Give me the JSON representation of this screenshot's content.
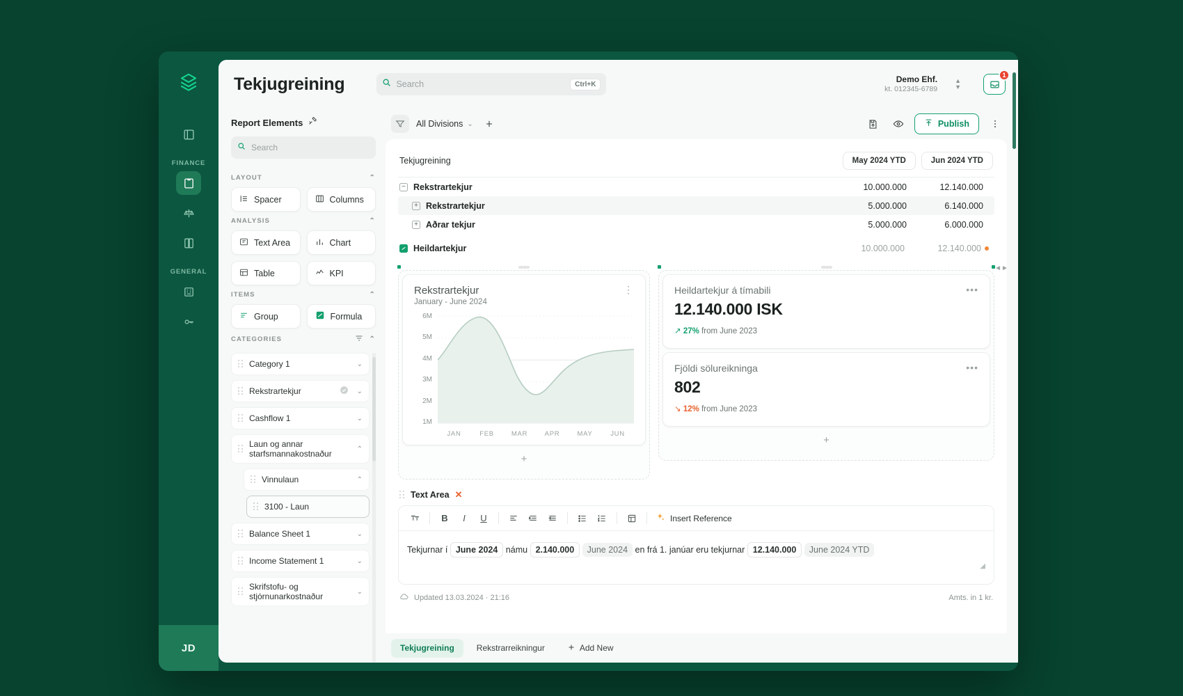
{
  "brand": {
    "accent": "#14a06e",
    "bg": "#07432f",
    "panel": "#0c5740"
  },
  "rail": {
    "logo_icon": "layers-logo-icon",
    "groups": [
      {
        "label": "FINANCE",
        "items": [
          {
            "icon": "dashboard-icon",
            "name": "dashboard",
            "active": false
          },
          {
            "icon": "clipboard-icon",
            "name": "reports",
            "active": true
          },
          {
            "icon": "scales-icon",
            "name": "balance",
            "active": false
          },
          {
            "icon": "book-icon",
            "name": "ledger",
            "active": false
          }
        ]
      },
      {
        "label": "GENERAL",
        "items": [
          {
            "icon": "building-icon",
            "name": "company",
            "active": false
          },
          {
            "icon": "key-icon",
            "name": "access",
            "active": false
          }
        ]
      }
    ],
    "avatar_initials": "JD"
  },
  "topbar": {
    "title": "Tekjugreining",
    "search": {
      "placeholder": "Search",
      "value": "",
      "shortcut": "Ctrl+K",
      "icon": "search-icon"
    },
    "org": {
      "name": "Demo Ehf.",
      "kt": "kt. 012345-6789"
    },
    "notifications": {
      "count": "1",
      "icon": "inbox-icon"
    }
  },
  "left_panel": {
    "heading": "Report Elements",
    "heading_icon": "tools-icon",
    "search": {
      "placeholder": "Search",
      "value": ""
    },
    "sections": [
      {
        "key": "layout",
        "label": "LAYOUT",
        "collapsed": false,
        "tiles": [
          {
            "label": "Spacer",
            "icon": "spacer-icon"
          },
          {
            "label": "Columns",
            "icon": "columns-icon"
          }
        ]
      },
      {
        "key": "analysis",
        "label": "ANALYSIS",
        "collapsed": false,
        "tiles": [
          {
            "label": "Text Area",
            "icon": "text-area-icon"
          },
          {
            "label": "Chart",
            "icon": "bar-chart-icon"
          },
          {
            "label": "Table",
            "icon": "table-icon"
          },
          {
            "label": "KPI",
            "icon": "kpi-icon"
          }
        ]
      },
      {
        "key": "items",
        "label": "ITEMS",
        "collapsed": false,
        "tiles": [
          {
            "label": "Group",
            "icon": "group-icon"
          },
          {
            "label": "Formula",
            "icon": "formula-icon"
          }
        ]
      }
    ],
    "categories_label": "CATEGORIES",
    "categories_filter_icon": "filter-icon",
    "categories": [
      {
        "label": "Category 1",
        "indent": 0,
        "chevron": "down",
        "badge": null
      },
      {
        "label": "Rekstrartekjur",
        "indent": 0,
        "chevron": "down",
        "badge": "check-circle-icon"
      },
      {
        "label": "Cashflow 1",
        "indent": 0,
        "chevron": "down",
        "badge": null
      },
      {
        "label": "Laun og annar starfsmannakostnaður",
        "indent": 0,
        "chevron": "up",
        "badge": null
      },
      {
        "label": "Vinnulaun",
        "indent": 1,
        "chevron": "up",
        "badge": null
      },
      {
        "label": "3100 - Laun",
        "indent": 2,
        "chevron": "none",
        "badge": null
      },
      {
        "label": "Balance Sheet 1",
        "indent": 0,
        "chevron": "down",
        "badge": null
      },
      {
        "label": "Income Statement 1",
        "indent": 0,
        "chevron": "down",
        "badge": null
      },
      {
        "label": "Skrifstofu- og stjórnunarkostnaður",
        "indent": 0,
        "chevron": "down",
        "badge": null
      }
    ]
  },
  "content_toolbar": {
    "filter_icon": "filter-icon",
    "divisions_label": "All Divisions",
    "add_icon": "plus-icon",
    "save_icon": "save-icon",
    "preview_icon": "eye-icon",
    "publish_label": "Publish",
    "publish_icon": "publish-icon",
    "more_icon": "more-vertical-icon"
  },
  "report": {
    "name": "Tekjugreining",
    "period_buttons": [
      "May 2024 YTD",
      "Jun 2024 YTD"
    ],
    "rows": [
      {
        "label": "Rekstrartekjur",
        "level": 0,
        "toggle": "minus",
        "v1": "10.000.000",
        "v2": "12.140.000",
        "highlight": false,
        "dot": false
      },
      {
        "label": "Rekstrartekjur",
        "level": 1,
        "toggle": "plus",
        "v1": "5.000.000",
        "v2": "6.140.000",
        "highlight": true,
        "dot": false
      },
      {
        "label": "Aðrar tekjur",
        "level": 1,
        "toggle": "plus",
        "v1": "5.000.000",
        "v2": "6.000.000",
        "highlight": false,
        "dot": false
      },
      {
        "label": "Heildartekjur",
        "level": 0,
        "toggle": "formula",
        "v1": "10.000.000",
        "v2": "12.140.000",
        "highlight": false,
        "dot": true
      }
    ]
  },
  "chart_data": {
    "type": "area",
    "title": "Rekstrartekjur",
    "subtitle": "January - June 2024",
    "categories": [
      "JAN",
      "FEB",
      "MAR",
      "APR",
      "MAY",
      "JUN"
    ],
    "values": [
      4.0,
      6.1,
      4.2,
      2.5,
      3.9,
      4.4
    ],
    "unit": "M",
    "ylabel": "",
    "xlabel": "",
    "yticks": [
      "6M",
      "5M",
      "4M",
      "3M",
      "2M",
      "1M"
    ],
    "ylim": [
      1,
      6
    ],
    "grid": true,
    "legend": "none",
    "series_color": "#b6cdc2",
    "fill_color": "#e9f1ed",
    "menu_icon": "kebab-icon",
    "add_label": "+"
  },
  "kpis": [
    {
      "label": "Heildartekjur á tímabili",
      "value": "12.140.000 ISK",
      "delta": "27%",
      "delta_dir": "up",
      "delta_suffix": "from June 2023",
      "menu_icon": "ellipsis-icon"
    },
    {
      "label": "Fjöldi sölureikninga",
      "value": "802",
      "delta": "12%",
      "delta_dir": "down",
      "delta_suffix": "from June 2023",
      "menu_icon": "ellipsis-icon"
    }
  ],
  "widget_add_label": "+",
  "text_area": {
    "block_label": "Text Area",
    "remove_icon": "close-icon",
    "toolbar": [
      {
        "icon": "font-size-icon",
        "label": "T"
      },
      {
        "icon": "bold-icon",
        "label": "B"
      },
      {
        "icon": "italic-icon",
        "label": "I"
      },
      {
        "icon": "underline-icon",
        "label": "U"
      },
      {
        "icon": "align-left-icon",
        "label": ""
      },
      {
        "icon": "indent-increase-icon",
        "label": ""
      },
      {
        "icon": "indent-decrease-icon",
        "label": ""
      },
      {
        "icon": "bullet-list-icon",
        "label": ""
      },
      {
        "icon": "numbered-list-icon",
        "label": ""
      },
      {
        "icon": "insert-table-icon",
        "label": ""
      }
    ],
    "insert_reference_label": "Insert Reference",
    "insert_reference_icon": "sparkle-icon",
    "content": [
      {
        "type": "text",
        "value": "Tekjurnar í"
      },
      {
        "type": "chip-white",
        "value": "June 2024"
      },
      {
        "type": "text",
        "value": "námu"
      },
      {
        "type": "chip-white",
        "value": "2.140.000"
      },
      {
        "type": "chip-grey",
        "value": "June 2024"
      },
      {
        "type": "text",
        "value": "en frá 1. janúar eru tekjurnar"
      },
      {
        "type": "chip-white",
        "value": "12.140.000"
      },
      {
        "type": "chip-grey",
        "value": "June 2024 YTD"
      }
    ]
  },
  "canvas_footer": {
    "updated_icon": "cloud-icon",
    "updated_text": "Updated 13.03.2024 · 21:16",
    "amounts_note": "Amts. in 1 kr."
  },
  "bottom_tabs": {
    "tabs": [
      {
        "label": "Tekjugreining",
        "active": true
      },
      {
        "label": "Rekstrarreikningur",
        "active": false
      }
    ],
    "add_label": "Add New",
    "add_icon": "plus-icon"
  }
}
